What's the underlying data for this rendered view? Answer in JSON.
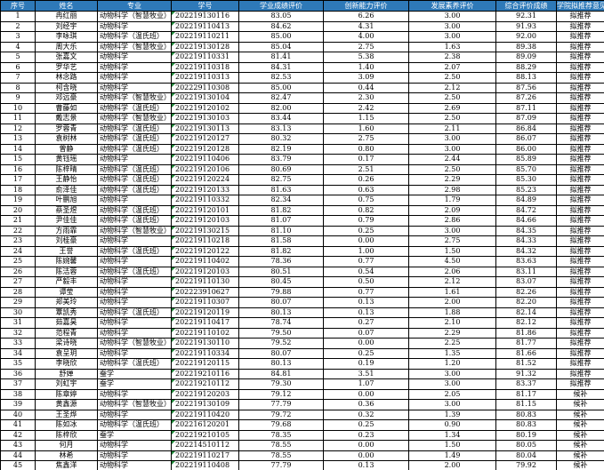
{
  "colors": {
    "header_bg": "#2e79b8",
    "header_text": "#ffffff",
    "grid": "#000000",
    "cell_marker": "#1f8a3a"
  },
  "headers": [
    "序号",
    "姓名",
    "专业",
    "学号",
    "学业成绩评价",
    "创新能力评价",
    "发展素养评价",
    "综合评价成绩",
    "学院拟推荐意见"
  ],
  "rows": [
    [
      "1",
      "冉红丽",
      "动物科学（智慧牧业）",
      "202219130116",
      "83.05",
      "6.26",
      "3.00",
      "92.31",
      "拟推荐"
    ],
    [
      "2",
      "刘经宇",
      "动物科学",
      "202219110413",
      "84.62",
      "4.31",
      "3.00",
      "91.93",
      "拟推荐"
    ],
    [
      "3",
      "李咏琪",
      "动物科学（温氏班）",
      "202219110211",
      "85.00",
      "4.00",
      "3.00",
      "92.00",
      "拟推荐"
    ],
    [
      "4",
      "周大乐",
      "动物科学（智慧牧业）",
      "202219130128",
      "85.04",
      "2.75",
      "1.63",
      "89.38",
      "拟推荐"
    ],
    [
      "5",
      "张嘉文",
      "动物科学",
      "202219110331",
      "81.41",
      "5.38",
      "2.38",
      "89.09",
      "拟推荐"
    ],
    [
      "6",
      "罗华艺",
      "动物科学",
      "202219110318",
      "84.31",
      "1.40",
      "2.07",
      "88.29",
      "拟推荐"
    ],
    [
      "7",
      "林念路",
      "动物科学",
      "202219110313",
      "82.53",
      "3.09",
      "2.50",
      "88.13",
      "拟推荐"
    ],
    [
      "8",
      "柯含晓",
      "动物科学",
      "202229110308",
      "85.00",
      "0.44",
      "2.12",
      "87.56",
      "拟推荐"
    ],
    [
      "9",
      "邓远豪",
      "动物科学（智慧牧业）",
      "202219130104",
      "82.47",
      "2.30",
      "2.50",
      "87.26",
      "拟推荐"
    ],
    [
      "10",
      "曹藤如",
      "动物科学（温氏班）",
      "202219120102",
      "82.00",
      "2.42",
      "2.69",
      "87.11",
      "拟推荐"
    ],
    [
      "11",
      "戴志景",
      "动物科学（智慧牧业）",
      "202219130103",
      "83.44",
      "1.15",
      "2.50",
      "87.09",
      "拟推荐"
    ],
    [
      "12",
      "罗蓉青",
      "动物科学（温氏班）",
      "202219130113",
      "83.13",
      "1.60",
      "2.11",
      "86.84",
      "拟推荐"
    ],
    [
      "13",
      "袁树林",
      "动物科学（温氏班）",
      "202219120127",
      "80.32",
      "2.75",
      "3.00",
      "86.07",
      "拟推荐"
    ],
    [
      "14",
      "曾静",
      "动物科学（温氏班）",
      "202219120128",
      "82.19",
      "0.80",
      "3.00",
      "86.00",
      "拟推荐"
    ],
    [
      "15",
      "黄钰瑶",
      "动物科学",
      "202219110406",
      "83.79",
      "0.17",
      "2.44",
      "85.89",
      "拟推荐"
    ],
    [
      "16",
      "陈梓晴",
      "动物科学（温氏班）",
      "202219120106",
      "80.69",
      "2.51",
      "2.50",
      "85.70",
      "拟推荐"
    ],
    [
      "17",
      "王静怡",
      "动物科学（温氏班）",
      "202219120224",
      "82.75",
      "0.26",
      "2.29",
      "85.30",
      "拟推荐"
    ],
    [
      "18",
      "俞泽佳",
      "动物科学（温氏班）",
      "202219120133",
      "81.63",
      "0.63",
      "2.98",
      "85.23",
      "拟推荐"
    ],
    [
      "19",
      "叶鹏旭",
      "动物科学",
      "202219110332",
      "82.34",
      "0.75",
      "1.79",
      "84.89",
      "拟推荐"
    ],
    [
      "20",
      "蔡圣煜",
      "动物科学（温氏班）",
      "202219120101",
      "81.82",
      "0.82",
      "2.09",
      "84.72",
      "拟推荐"
    ],
    [
      "21",
      "尹佳佳",
      "动物科学（温氏班）",
      "202219120103",
      "81.07",
      "0.79",
      "2.86",
      "84.66",
      "拟推荐"
    ],
    [
      "22",
      "方雨霏",
      "动物科学（智慧牧业）",
      "202219130215",
      "81.10",
      "0.25",
      "3.00",
      "84.35",
      "拟推荐"
    ],
    [
      "23",
      "刘桂豪",
      "动物科学",
      "202219110218",
      "81.58",
      "0.00",
      "2.75",
      "84.33",
      "拟推荐"
    ],
    [
      "24",
      "王誉",
      "动物科学（温氏班）",
      "202219120122",
      "81.82",
      "1.00",
      "1.50",
      "84.32",
      "拟推荐"
    ],
    [
      "25",
      "陈婉馨",
      "动物科学",
      "202219110402",
      "78.36",
      "0.77",
      "4.50",
      "83.63",
      "拟推荐"
    ],
    [
      "26",
      "陈洁蓉",
      "动物科学（温氏班）",
      "202219120103",
      "80.51",
      "0.54",
      "2.06",
      "83.11",
      "拟推荐"
    ],
    [
      "27",
      "严毅丰",
      "动物科学",
      "202219110130",
      "80.45",
      "0.50",
      "2.12",
      "83.07",
      "拟推荐"
    ],
    [
      "28",
      "谭莹",
      "动物科学",
      "202223910627",
      "79.88",
      "0.77",
      "1.61",
      "82.26",
      "拟推荐"
    ],
    [
      "29",
      "郑美玲",
      "动物科学",
      "202219110307",
      "80.07",
      "0.13",
      "2.00",
      "82.20",
      "拟推荐"
    ],
    [
      "30",
      "覃凯秀",
      "动物科学（温氏班）",
      "202219120119",
      "80.13",
      "0.13",
      "1.88",
      "82.14",
      "拟推荐"
    ],
    [
      "31",
      "茹嘉昊",
      "动物科学",
      "202219110417",
      "78.74",
      "0.27",
      "2.10",
      "82.12",
      "拟推荐"
    ],
    [
      "32",
      "范程青",
      "动物科学",
      "202219110102",
      "79.50",
      "0.07",
      "2.29",
      "81.86",
      "拟推荐"
    ],
    [
      "33",
      "梁诗晓",
      "动物科学（智慧牧业）",
      "202219130110",
      "79.52",
      "0.00",
      "2.25",
      "81.77",
      "拟推荐"
    ],
    [
      "34",
      "袁呈玥",
      "动物科学",
      "202219110334",
      "80.07",
      "0.25",
      "1.35",
      "81.66",
      "拟推荐"
    ],
    [
      "35",
      "李晓欣",
      "动物科学（温氏班）",
      "202219120115",
      "80.13",
      "0.19",
      "1.20",
      "81.52",
      "拟推荐"
    ],
    [
      "36",
      "舒婵",
      "蚕学",
      "202219210116",
      "84.81",
      "3.51",
      "3.00",
      "91.32",
      "拟推荐"
    ],
    [
      "37",
      "刘虹宇",
      "蚕学",
      "202219210112",
      "79.30",
      "1.07",
      "3.00",
      "83.37",
      "拟推荐"
    ],
    [
      "38",
      "陈章婷",
      "动物科学",
      "202219120203",
      "79.12",
      "0.00",
      "2.05",
      "81.17",
      "候补"
    ],
    [
      "39",
      "黄鑫源",
      "动物科学（智慧牧业）",
      "202219130109",
      "77.79",
      "0.36",
      "3.00",
      "81.15",
      "候补"
    ],
    [
      "40",
      "王圣烨",
      "动物科学",
      "202219110420",
      "79.72",
      "0.32",
      "1.39",
      "80.83",
      "候补"
    ],
    [
      "41",
      "陈如冰",
      "动物科学（温氏班）",
      "202216120201",
      "79.68",
      "0.25",
      "0.90",
      "80.83",
      "候补"
    ],
    [
      "42",
      "陈梓欣",
      "蚕学",
      "202219210105",
      "78.35",
      "0.23",
      "1.34",
      "80.19",
      "候补"
    ],
    [
      "43",
      "何月",
      "动物科学",
      "202214510112",
      "78.55",
      "0.00",
      "1.50",
      "80.05",
      "候补"
    ],
    [
      "44",
      "林希",
      "动物科学",
      "202219110217",
      "78.55",
      "0.00",
      "1.49",
      "80.04",
      "候补"
    ],
    [
      "45",
      "焦鑫洋",
      "动物科学",
      "202219110408",
      "77.79",
      "0.13",
      "2.00",
      "79.92",
      "候补"
    ]
  ]
}
